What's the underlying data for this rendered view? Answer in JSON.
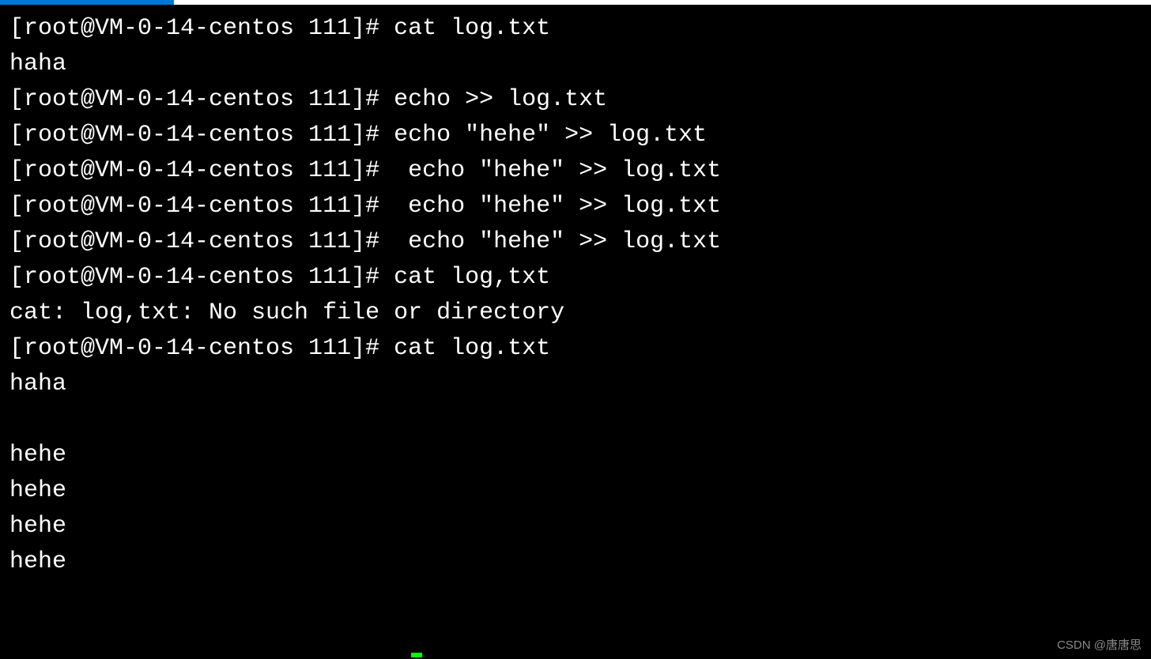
{
  "lines": [
    {
      "prompt": "[root@VM-0-14-centos 111]# ",
      "command": "cat log.txt"
    },
    {
      "output": "haha"
    },
    {
      "prompt": "[root@VM-0-14-centos 111]# ",
      "command": "echo >> log.txt"
    },
    {
      "prompt": "[root@VM-0-14-centos 111]# ",
      "command": "echo \"hehe\" >> log.txt"
    },
    {
      "prompt": "[root@VM-0-14-centos 111]# ",
      "command": " echo \"hehe\" >> log.txt"
    },
    {
      "prompt": "[root@VM-0-14-centos 111]# ",
      "command": " echo \"hehe\" >> log.txt"
    },
    {
      "prompt": "[root@VM-0-14-centos 111]# ",
      "command": " echo \"hehe\" >> log.txt"
    },
    {
      "prompt": "[root@VM-0-14-centos 111]# ",
      "command": "cat log,txt"
    },
    {
      "output": "cat: log,txt: No such file or directory"
    },
    {
      "prompt": "[root@VM-0-14-centos 111]# ",
      "command": "cat log.txt"
    },
    {
      "output": "haha"
    },
    {
      "output": ""
    },
    {
      "output": "hehe"
    },
    {
      "output": "hehe"
    },
    {
      "output": "hehe"
    },
    {
      "output": "hehe"
    }
  ],
  "watermark": "CSDN @唐唐思"
}
